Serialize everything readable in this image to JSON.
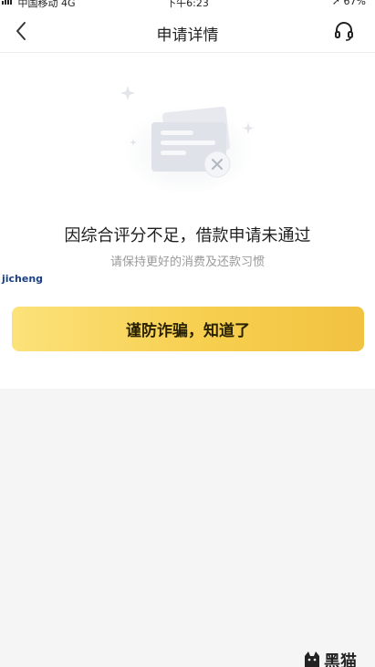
{
  "status_bar": {
    "carrier": "中国移动",
    "network": "4G",
    "time": "下午6:23",
    "battery": "67%"
  },
  "nav": {
    "title": "申请详情"
  },
  "result": {
    "title": "因综合评分不足，借款申请未通过",
    "subtitle": "请保持更好的消费及还款习惯"
  },
  "actions": {
    "confirm_label": "谨防诈骗，知道了"
  },
  "watermarks": {
    "left_text": "jicheng",
    "corner_text": "黑猫"
  },
  "colors": {
    "button_gradient_start": "#fbe27a",
    "button_gradient_end": "#f2c241",
    "button_text": "#2a2100",
    "subtitle": "#9a9a9a",
    "page_bg": "#f5f5f6"
  },
  "icons": {
    "back": "chevron-left-icon",
    "support": "headset-icon",
    "illustration": "rejected-card-icon"
  }
}
